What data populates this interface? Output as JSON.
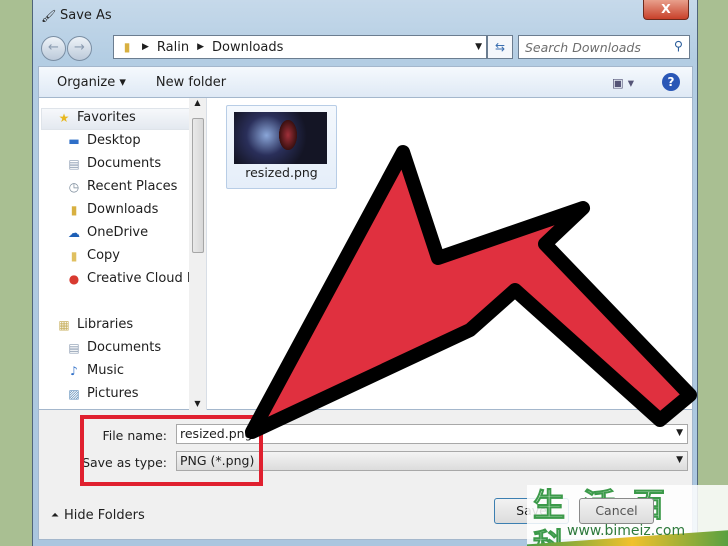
{
  "window": {
    "title": "Save As",
    "close": "X"
  },
  "address": {
    "segments": [
      "Ralin",
      "Downloads"
    ],
    "search_placeholder": "Search Downloads"
  },
  "toolbar": {
    "organize": "Organize ▾",
    "new_folder": "New folder",
    "help": "?"
  },
  "sidebar": {
    "favorites": {
      "label": "Favorites",
      "items": [
        {
          "label": "Desktop",
          "icon": "desktop-icon"
        },
        {
          "label": "Documents",
          "icon": "documents-icon"
        },
        {
          "label": "Recent Places",
          "icon": "recent-places-icon"
        },
        {
          "label": "Downloads",
          "icon": "downloads-icon"
        },
        {
          "label": "OneDrive",
          "icon": "cloud-icon"
        },
        {
          "label": "Copy",
          "icon": "folder-icon"
        },
        {
          "label": "Creative Cloud Fil",
          "icon": "creative-cloud-icon"
        }
      ]
    },
    "libraries": {
      "label": "Libraries",
      "items": [
        {
          "label": "Documents",
          "icon": "documents-icon"
        },
        {
          "label": "Music",
          "icon": "music-icon"
        },
        {
          "label": "Pictures",
          "icon": "pictures-icon"
        }
      ]
    }
  },
  "files": [
    {
      "name": "resized.png"
    }
  ],
  "form": {
    "file_name_label": "File name:",
    "file_name_value": "resized.png",
    "type_label": "Save as type:",
    "type_value": "PNG (*.png)"
  },
  "footer": {
    "hide_folders": "Hide Folders",
    "save": "Save",
    "cancel": "Cancel"
  },
  "watermark": {
    "text": "生活百科",
    "url": "www.bimeiz.com"
  },
  "colors": {
    "highlight": "#e0202f",
    "arrow": "#e0303f"
  }
}
